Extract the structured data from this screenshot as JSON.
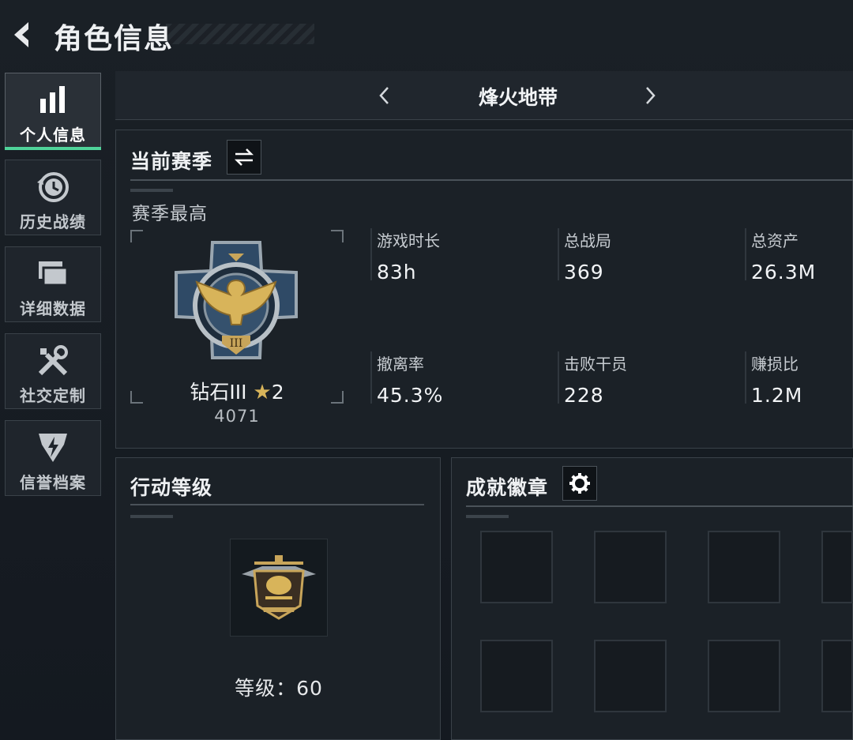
{
  "header": {
    "title": "角色信息"
  },
  "sidebar": {
    "items": [
      {
        "label": "个人信息",
        "icon": "bar-chart-icon",
        "active": true
      },
      {
        "label": "历史战绩",
        "icon": "history-clock-icon",
        "active": false
      },
      {
        "label": "详细数据",
        "icon": "stacked-cards-icon",
        "active": false
      },
      {
        "label": "社交定制",
        "icon": "tools-icon",
        "active": false
      },
      {
        "label": "信誉档案",
        "icon": "shield-badge-icon",
        "active": false
      }
    ]
  },
  "mode": {
    "name": "烽火地带"
  },
  "season": {
    "title": "当前赛季",
    "best_label": "赛季最高",
    "rank_name": "钻石III",
    "rank_stars": "2",
    "rank_score": "4071",
    "stats": [
      {
        "label": "游戏时长",
        "value": "83h"
      },
      {
        "label": "总战局",
        "value": "369"
      },
      {
        "label": "总资产",
        "value": "26.3M"
      },
      {
        "label": "撤离率",
        "value": "45.3%"
      },
      {
        "label": "击败干员",
        "value": "228"
      },
      {
        "label": "赚损比",
        "value": "1.2M"
      }
    ]
  },
  "action": {
    "title": "行动等级",
    "level_text": "等级：60"
  },
  "badges": {
    "title": "成就徽章"
  },
  "colors": {
    "accent": "#4fd39a",
    "gold": "#d8b45a",
    "panel": "#1b2127"
  }
}
